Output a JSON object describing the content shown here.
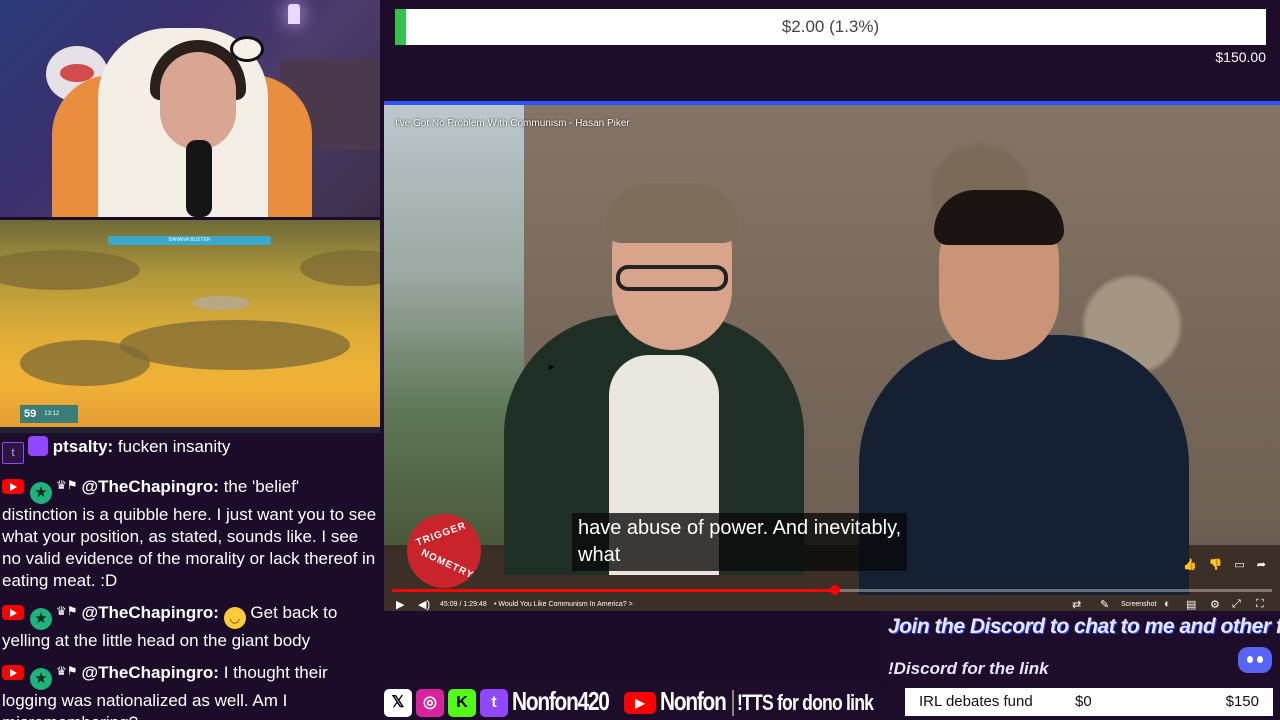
{
  "game": {
    "bar_label": "BANANA BUSTER",
    "hud_value": "59",
    "hud_time": "13:12"
  },
  "chat": {
    "messages": [
      {
        "user": "ptsalty:",
        "text": " fucken insanity"
      },
      {
        "user": "@TheChapingro:",
        "text": " the 'belief' distinction is a quibble here. I just want you to see what your position, as stated, sounds like. I see no valid evidence of the morality or lack thereof in eating meat. :D"
      },
      {
        "user": "@TheChapingro:",
        "text": " Get back to yelling at the little head on the giant body"
      },
      {
        "user": "@TheChapingro:",
        "text": " I thought their logging was nationalized as well. Am I misremembering?"
      }
    ]
  },
  "goal": {
    "label": "$2.00 (1.3%)",
    "target": "$150.00",
    "progress": 0.013
  },
  "video": {
    "title": "I've Got No Problem With Communism - Hasan Piker",
    "logo_line1": "TRIGGER",
    "logo_line2": "NOMETRY",
    "caption_line1": "have abuse of power. And inevitably,",
    "caption_line2": "what",
    "time": "45:09 / 1:29:48",
    "chapter": "• Would You Like Communism In America? >",
    "screenshot_label": "Screenshot",
    "progress": 0.503
  },
  "overlay": {
    "discord_title": "Join the Discord to chat to me and other fans!",
    "discord_sub": "!Discord for the link",
    "handle1": "Nonfon420",
    "handle2": "Nonfon",
    "tts": "!TTS for dono link",
    "fund_name": "IRL debates fund",
    "fund_current": "$0",
    "fund_target": "$150"
  },
  "colors": {
    "accent_blue": "#2c52ff",
    "goal_green": "#35c24a",
    "youtube_red": "#ff0000",
    "twitch_purple": "#9146ff"
  }
}
